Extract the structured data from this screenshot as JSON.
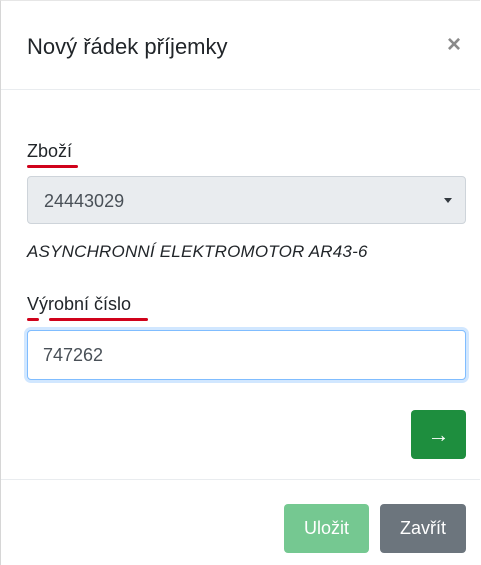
{
  "modal": {
    "title": "Nový řádek příjemky",
    "close_glyph": "×",
    "close_icon": "close-icon"
  },
  "form": {
    "goods_label": "Zboží",
    "goods_selected": "24443029",
    "product_name": "ASYNCHRONNÍ ELEKTROMOTOR AR43-6",
    "serial_label": "Výrobní číslo",
    "serial_value": "747262",
    "next_icon": "arrow-right-icon",
    "next_glyph": "→"
  },
  "footer": {
    "save_label": "Uložit",
    "close_label": "Zavřít"
  },
  "colors": {
    "spellcheck_underline": "#d0021b",
    "next_button": "#1e8e3e",
    "save_button": "#5dbf7e",
    "close_button": "#6c757d"
  }
}
